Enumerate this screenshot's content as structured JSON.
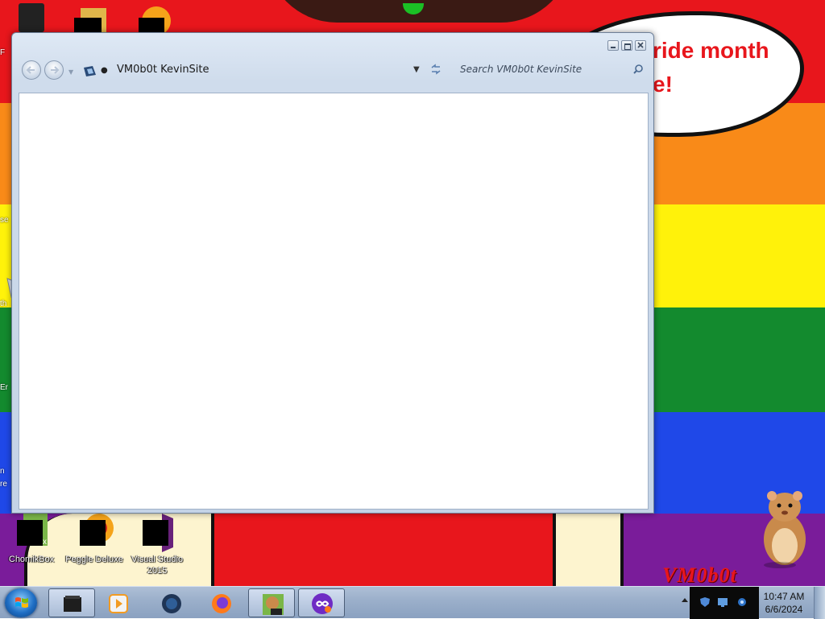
{
  "window": {
    "title": "VM0b0t KevinSite",
    "search_placeholder": "Search VM0b0t KevinSite"
  },
  "wallpaper": {
    "bubble_text": "ride month\ne!",
    "brand_text": "VM0b0t",
    "left_fragments": [
      "F",
      "se",
      "th",
      "Er",
      "n",
      "re"
    ],
    "colors": {
      "red": "#e8161c",
      "orange": "#f98a18",
      "yellow": "#fff20a",
      "green": "#138a2e",
      "blue": "#1f48e8",
      "purple": "#7a1c9a"
    }
  },
  "desktop_icons": [
    {
      "label": "ChomikBox",
      "icon": "chomikbox-icon"
    },
    {
      "label": "Peggle Deluxe",
      "icon": "peggle-icon"
    },
    {
      "label": "Visual Studio 2015",
      "icon": "visual-studio-icon"
    }
  ],
  "taskbar": {
    "items": [
      {
        "name": "explorer",
        "icon": "folder-icon",
        "active": true
      },
      {
        "name": "media-player",
        "icon": "media-player-icon",
        "active": false
      },
      {
        "name": "network",
        "icon": "globe-icon",
        "active": false
      },
      {
        "name": "firefox",
        "icon": "firefox-icon",
        "active": false
      },
      {
        "name": "chomikbox",
        "icon": "chomikbox-icon",
        "active": true
      },
      {
        "name": "app",
        "icon": "app-icon",
        "active": true
      }
    ],
    "clock_time": "10:47 AM",
    "clock_date": "6/6/2024"
  }
}
